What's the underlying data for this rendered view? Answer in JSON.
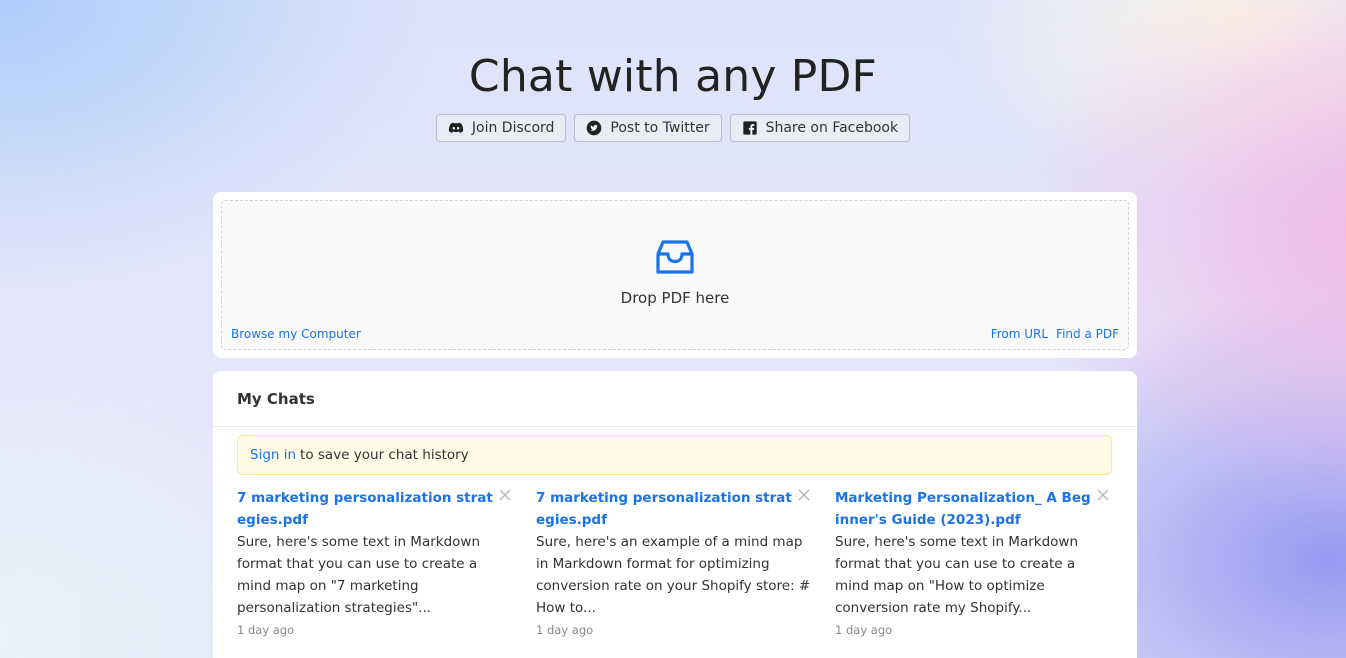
{
  "header": {
    "title": "Chat with any PDF"
  },
  "social": [
    {
      "label": "Join Discord",
      "icon": "discord-icon"
    },
    {
      "label": "Post to Twitter",
      "icon": "twitter-icon"
    },
    {
      "label": "Share on Facebook",
      "icon": "facebook-icon"
    }
  ],
  "upload": {
    "icon": "inbox-icon",
    "drop_label": "Drop PDF here",
    "browse_label": "Browse my Computer",
    "from_url_label": "From URL",
    "find_pdf_label": "Find a PDF",
    "accent_color": "#1a73e8"
  },
  "chats": {
    "heading": "My Chats",
    "signin_link": "Sign in",
    "signin_text": "to save your chat history",
    "items": [
      {
        "title": "7 marketing personalization strategies.pdf",
        "snippet": "Sure, here's some text in Markdown format that you can use to create a mind map on \"7 marketing personalization strategies\"...",
        "time": "1 day ago"
      },
      {
        "title": "7 marketing personalization strategies.pdf",
        "snippet": "Sure, here's an example of a mind map in Markdown format for optimizing conversion rate on your Shopify store: # How to...",
        "time": "1 day ago"
      },
      {
        "title": "Marketing Personalization_ A Beginner's Guide (2023).pdf",
        "snippet": "Sure, here's some text in Markdown format that you can use to create a mind map on \"How to optimize conversion rate my Shopify...",
        "time": "1 day ago"
      }
    ]
  }
}
